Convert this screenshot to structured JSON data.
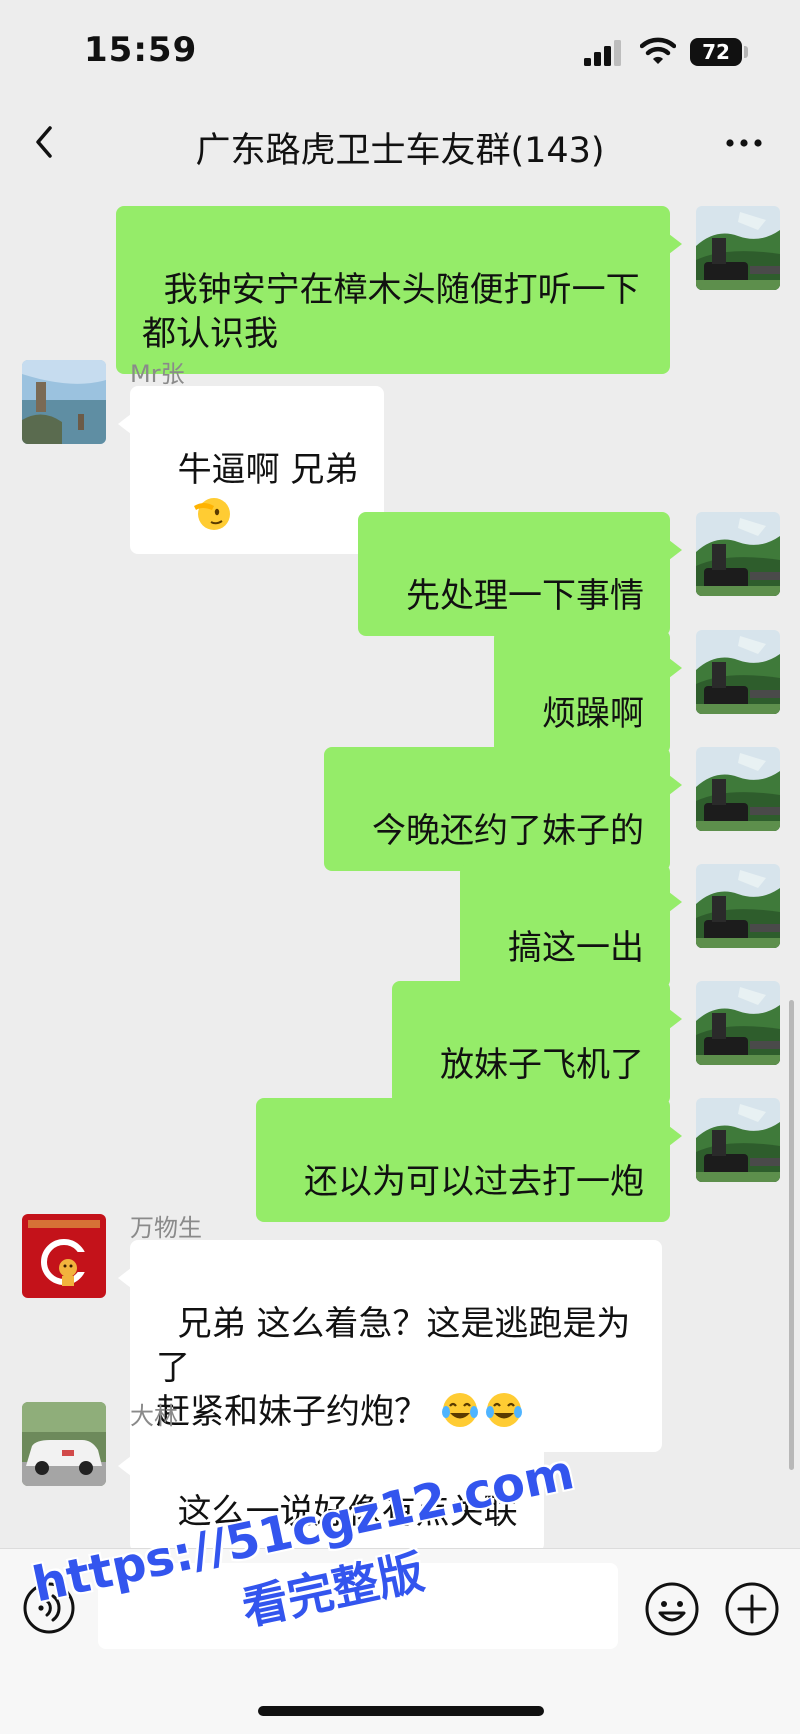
{
  "status_bar": {
    "time": "15:59",
    "battery": "72"
  },
  "nav": {
    "title": "广东路虎卫士车友群(143)"
  },
  "messages": [
    {
      "side": "out",
      "text": "我钟安宁在樟木头随便打听一下\n都认识我"
    },
    {
      "side": "in",
      "sender": "Mr张",
      "text": "牛逼啊 兄弟",
      "emoji": "saluting-face-emoji"
    },
    {
      "side": "out",
      "text": "先处理一下事情"
    },
    {
      "side": "out",
      "text": "烦躁啊"
    },
    {
      "side": "out",
      "text": "今晚还约了妹子的"
    },
    {
      "side": "out",
      "text": "搞这一出"
    },
    {
      "side": "out",
      "text": "放妹子飞机了"
    },
    {
      "side": "out",
      "text": "还以为可以过去打一炮"
    },
    {
      "side": "in",
      "sender": "万物生",
      "text": "兄弟 这么着急？这是逃跑是为了\n赶紧和妹子约炮？",
      "emoji": "tears-of-joy-emoji x2"
    },
    {
      "side": "in",
      "sender": "大林",
      "text": "这么一说好像有点关联"
    }
  ],
  "input": {
    "placeholder": ""
  },
  "watermark": {
    "url": "https://51cgz12.com",
    "subtitle": "看完整版"
  },
  "colors": {
    "background": "#ededed",
    "outgoing_bubble": "#95ec69",
    "incoming_bubble": "#ffffff",
    "watermark": "#3355ee"
  }
}
